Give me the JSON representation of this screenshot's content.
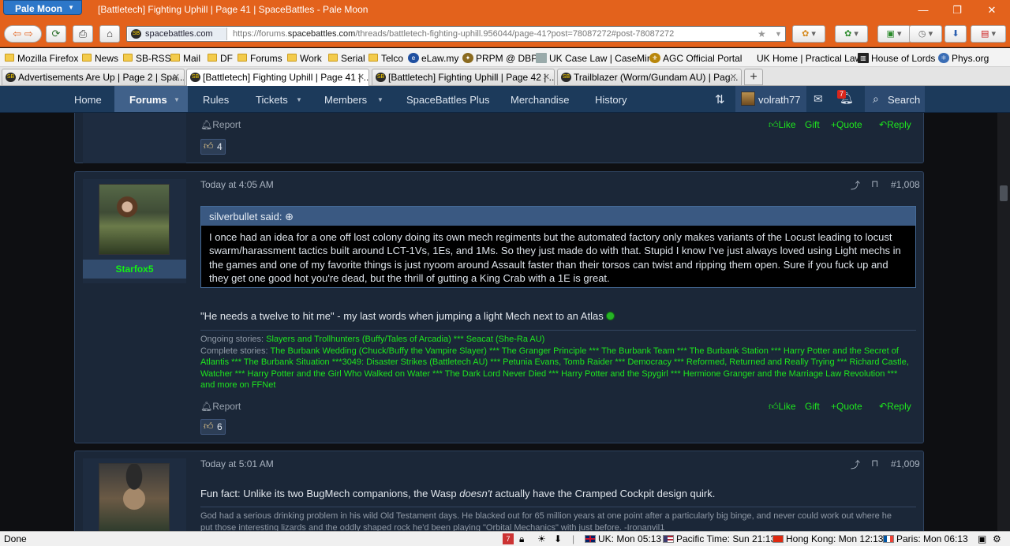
{
  "browser": {
    "app_button": "Pale Moon",
    "window_title": "[Battletech] Fighting Uphill | Page 41 | SpaceBattles - Pale Moon",
    "site_identity": "spacebattles.com",
    "url_prefix": "https://forums.",
    "url_domain": "spacebattles.com",
    "url_rest": "/threads/battletech-fighting-uphill.956044/page-41?post=78087272#post-78087272",
    "bookmarks": [
      "Mozilla Firefox",
      "News",
      "SB-RSS",
      "Mail",
      "DF",
      "Forums",
      "Work",
      "Serial",
      "Telco",
      "eLaw.my",
      "PRPM @ DBP",
      "UK Case Law | CaseMine",
      "AGC Official Portal",
      "UK Home | Practical Law",
      "House of Lords",
      "Phys.org"
    ],
    "tabs": [
      "Advertisements Are Up | Page 2 | Spa...",
      "[Battletech] Fighting Uphill | Page 41 | ...",
      "[Battletech] Fighting Uphill | Page 42 | ...",
      "Trailblazer (Worm/Gundam AU) | Pag..."
    ],
    "status": {
      "left": "Done",
      "uk": "UK: Mon 05:13",
      "pacific": "Pacific Time: Sun 21:13",
      "hongkong": "Hong Kong: Mon 12:13",
      "paris": "Paris: Mon 06:13",
      "badge": "7"
    }
  },
  "site": {
    "nav": [
      "Home",
      "Forums",
      "Rules",
      "Tickets",
      "Members",
      "SpaceBattles Plus",
      "Merchandise",
      "History"
    ],
    "user": "volrath77",
    "alert_count": "7",
    "search": "Search"
  },
  "actions": {
    "report": "Report",
    "like": "Like",
    "gift": "Gift",
    "quote": "Quote",
    "reply": "Reply"
  },
  "post_top": {
    "reactions": "4"
  },
  "post1": {
    "author": "Starfox5",
    "time": "Today at 4:05 AM",
    "number": "#1,008",
    "quote_author": "silverbullet said:",
    "quote_lines": [
      "I once had an idea for a one off lost colony doing its own mech regiments but the automated factory only makes variants of the Locust leading to locust",
      "swarm/harassment tactics built around LCT-1Vs, 1Es, and 1Ms. So they just made do with that. Stupid I know I've just always loved using Light mechs in",
      "the games and one of my favorite things is just nyoom around Assault faster than their torsos can twist and ripping them open. Sure if you fuck up and",
      "they get one good hot you're dead, but the thrill of gutting a King Crab with a 1E is great."
    ],
    "body": "\"He needs a twelve to hit me\" - my last words when jumping a light Mech next to an Atlas",
    "sig_ongoing_label": "Ongoing stories: ",
    "sig_ongoing": "Slayers and Trollhunters (Buffy/Tales of Arcadia) *** Seacat (She-Ra AU)",
    "sig_complete_label": "Complete stories: ",
    "sig_complete_l1": "The Burbank Wedding (Chuck/Buffy the Vampire Slayer) *** The Granger Principle *** The Burbank Team *** The Burbank Station *** Harry Potter and the Secret of",
    "sig_complete_l2": "Atlantis *** The Burbank Situation ***3049: Disaster Strikes (Battletech AU) *** Petunia Evans, Tomb Raider *** Democracy *** Reformed, Returned and Really Trying *** Richard Castle,",
    "sig_complete_l3": "Watcher *** Harry Potter and the Girl Who Walked on Water *** The Dark Lord Never Died *** Harry Potter and the Spygirl *** Hermione Granger and the Marriage Law Revolution ***",
    "sig_complete_l4": "and more on FFNet",
    "reactions": "6"
  },
  "post2": {
    "time": "Today at 5:01 AM",
    "number": "#1,009",
    "body_pre": "Fun fact: Unlike its two BugMech companions, the Wasp ",
    "body_em": "doesn't",
    "body_post": " actually have the Cramped Cockpit design quirk.",
    "sig_l1": "God had a serious drinking problem in his wild Old Testament days. He blacked out for 65 million years at one point after a particularly big binge, and never could work out where he",
    "sig_l2": "put those interesting lizards and the oddly shaped rock he'd been playing \"Orbital Mechanics\" with just before. -Ironanvil1"
  }
}
